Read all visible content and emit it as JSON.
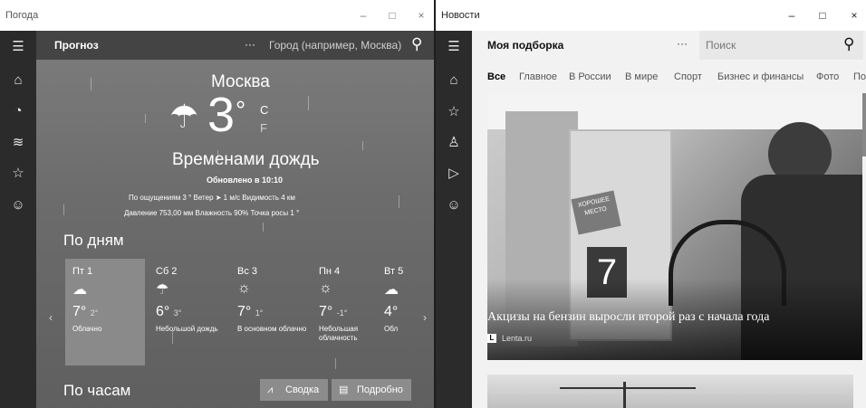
{
  "weather": {
    "window_title": "Погода",
    "controls": [
      "–",
      "□",
      "×"
    ],
    "header": {
      "title": "Прогноз",
      "more": "···",
      "search_placeholder": "Город (например, Москва)"
    },
    "city": "Москва",
    "temperature": "3",
    "deg": "°",
    "unit_c": "C",
    "unit_f": "F",
    "condition": "Временами дождь",
    "updated": "Обновлено в 10:10",
    "details1": "По ощущениям  3 °    Ветер  ➤ 1 м/с    Видимость  4 км",
    "details2": "Давление  753,00 мм    Влажность  90%    Точка росы  1 °",
    "daily_title": "По дням",
    "days": [
      {
        "name": "Пт 1",
        "hi": "7°",
        "lo": "2°",
        "desc": "Облачно"
      },
      {
        "name": "Сб 2",
        "hi": "6°",
        "lo": "3°",
        "desc": "Небольшой дождь"
      },
      {
        "name": "Вс 3",
        "hi": "7°",
        "lo": "1°",
        "desc": "В основном облачно"
      },
      {
        "name": "Пн 4",
        "hi": "7°",
        "lo": "-1°",
        "desc": "Небольшая облачность"
      },
      {
        "name": "Вт 5",
        "hi": "4°",
        "lo": "",
        "desc": "Обл"
      }
    ],
    "hourly_title": "По часам",
    "summary_btn": "Сводка",
    "detail_btn": "Подробно"
  },
  "news": {
    "window_title": "Новости",
    "controls": [
      "–",
      "□",
      "×"
    ],
    "header": {
      "title": "Моя подборка",
      "more": "···",
      "search_placeholder": "Поиск"
    },
    "tabs": [
      "Все",
      "Главное",
      "В России",
      "В мире",
      "Спорт",
      "Бизнес и финансы",
      "Фото",
      "По"
    ],
    "headline": "Акцизы на бензин выросли второй раз с начала года",
    "source_badge": "L",
    "source": "Lenta.ru",
    "sign_text": "ХОРОШЕЕ МЕСТО",
    "pump_number": "7"
  }
}
